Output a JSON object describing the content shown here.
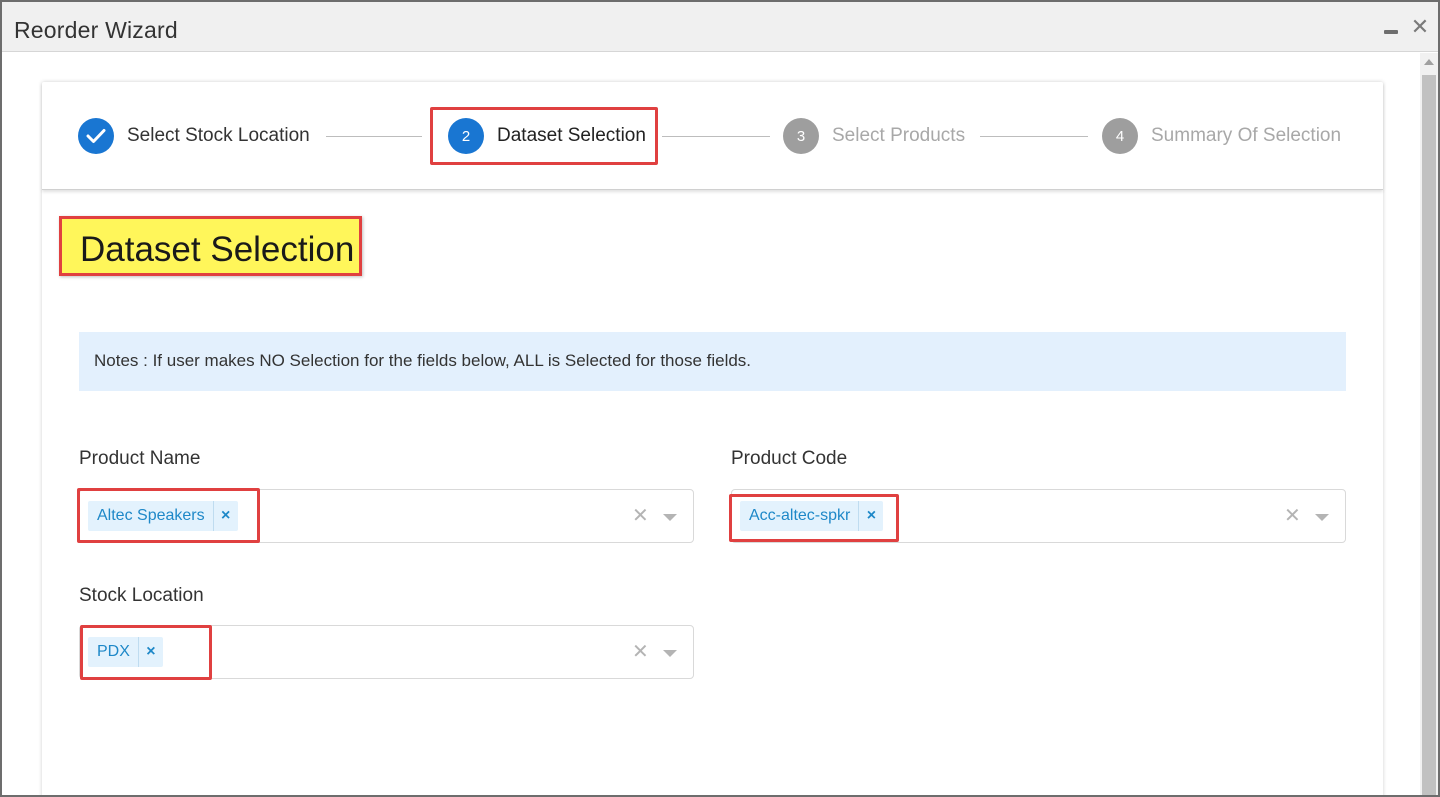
{
  "window": {
    "title": "Reorder Wizard",
    "minimize_icon": "minimize-icon",
    "close_glyph": "✕"
  },
  "stepper": {
    "steps": [
      {
        "number": "✓",
        "label": "Select Stock Location",
        "state": "done"
      },
      {
        "number": "2",
        "label": "Dataset Selection",
        "state": "active"
      },
      {
        "number": "3",
        "label": "Select Products",
        "state": "pending"
      },
      {
        "number": "4",
        "label": "Summary Of Selection",
        "state": "pending"
      }
    ]
  },
  "page": {
    "title": "Dataset Selection",
    "notes": "Notes : If user makes NO Selection for the fields below, ALL is Selected for those fields."
  },
  "fields": {
    "product_name": {
      "label": "Product Name",
      "chips": [
        "Altec Speakers"
      ]
    },
    "product_code": {
      "label": "Product Code",
      "chips": [
        "Acc-altec-spkr"
      ]
    },
    "stock_location": {
      "label": "Stock Location",
      "chips": [
        "PDX"
      ]
    }
  },
  "glyphs": {
    "chip_remove": "×",
    "clear": "✕"
  },
  "colors": {
    "accent": "#1976d2",
    "pending_step": "#9e9e9e",
    "chip_bg": "#e3f2fd",
    "chip_text": "#1e88c8",
    "notes_bg": "#e3f0fd",
    "highlight": "#fff65a",
    "annotation_border": "#e04040"
  }
}
